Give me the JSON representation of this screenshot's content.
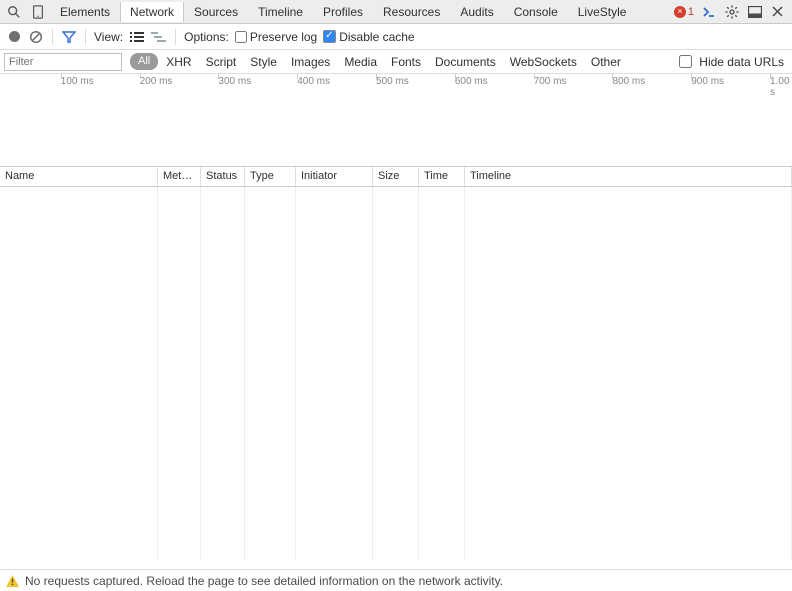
{
  "tabs": {
    "items": [
      "Elements",
      "Network",
      "Sources",
      "Timeline",
      "Profiles",
      "Resources",
      "Audits",
      "Console",
      "LiveStyle"
    ],
    "active": "Network"
  },
  "errors_count": "1",
  "toolbar": {
    "view_label": "View:",
    "options_label": "Options:",
    "preserve_log_label": "Preserve log",
    "disable_cache_label": "Disable cache",
    "preserve_log_checked": false,
    "disable_cache_checked": true
  },
  "filterbar": {
    "placeholder": "Filter",
    "value": "",
    "type_pill": "All",
    "types": [
      "XHR",
      "Script",
      "Style",
      "Images",
      "Media",
      "Fonts",
      "Documents",
      "WebSockets",
      "Other"
    ],
    "hide_data_urls_label": "Hide data URLs",
    "hide_data_urls_checked": false
  },
  "timeline_ticks": [
    "100 ms",
    "200 ms",
    "300 ms",
    "400 ms",
    "500 ms",
    "600 ms",
    "700 ms",
    "800 ms",
    "900 ms",
    "1.00 s"
  ],
  "columns": {
    "name": "Name",
    "method_abbrev": "Meth…",
    "status": "Status",
    "type": "Type",
    "initiator": "Initiator",
    "size": "Size",
    "time": "Time",
    "timeline": "Timeline"
  },
  "status_message": "No requests captured. Reload the page to see detailed information on the network activity."
}
